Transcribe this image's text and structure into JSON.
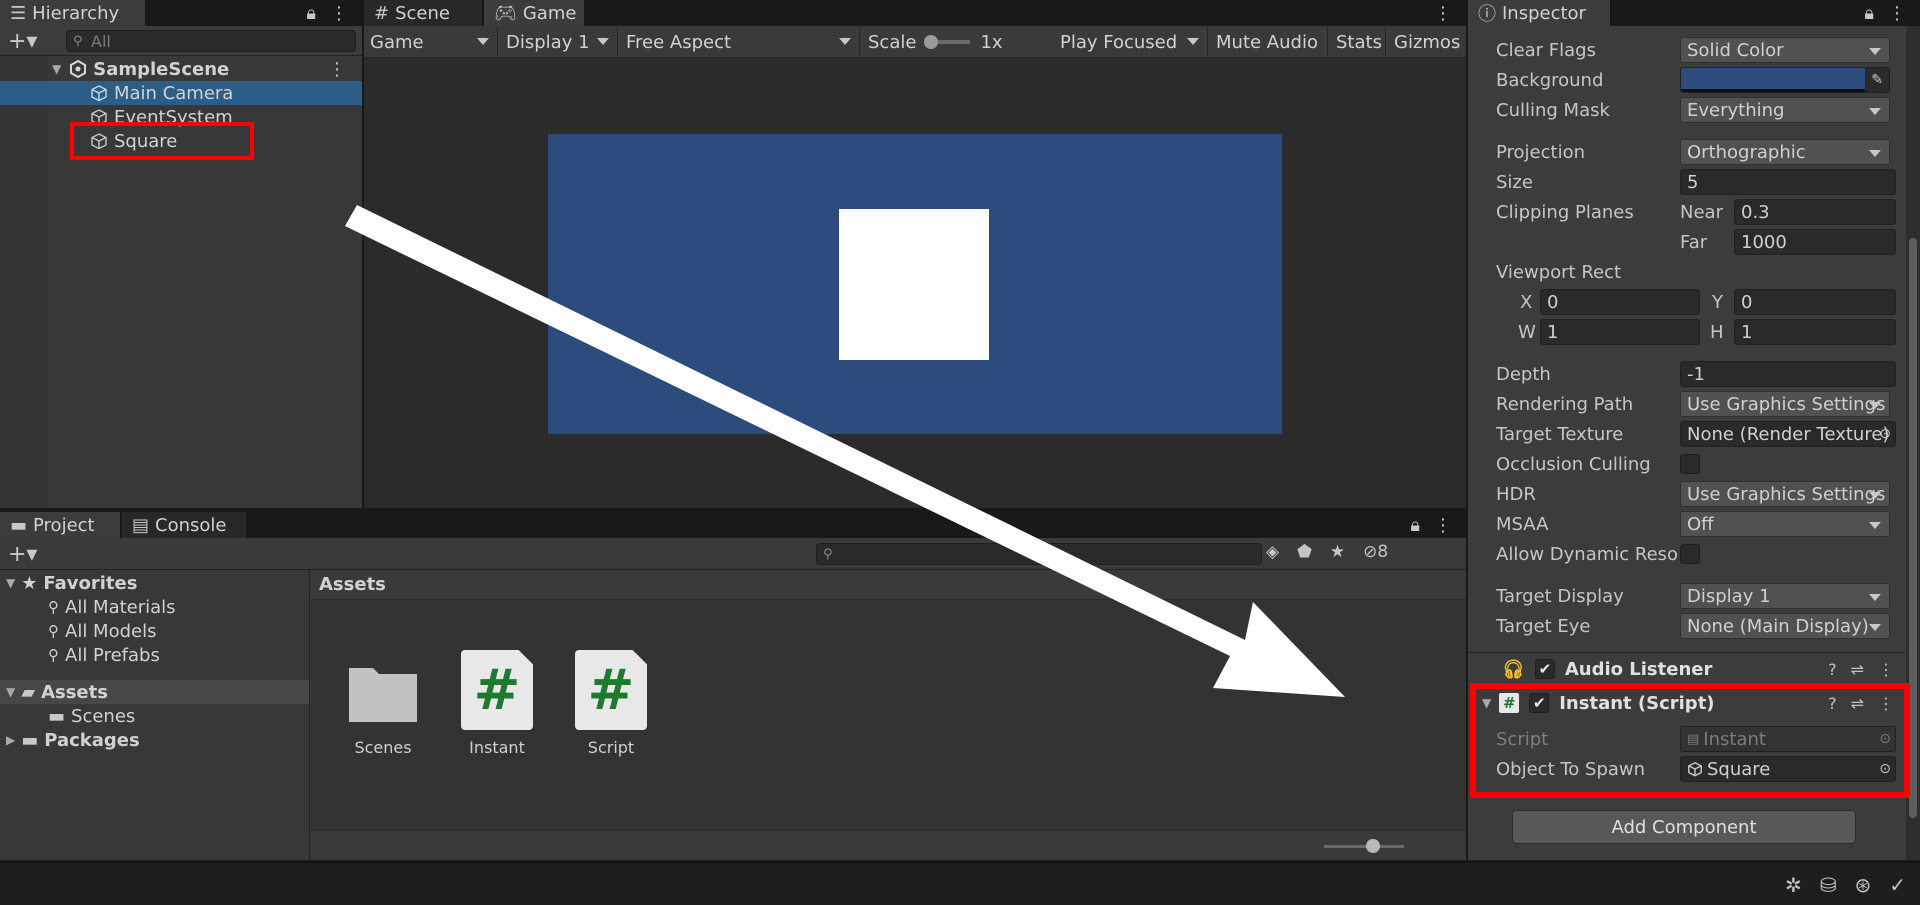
{
  "hierarchy": {
    "tab_label": "Hierarchy",
    "search_placeholder": "All",
    "scene_name": "SampleScene",
    "items": [
      {
        "label": "Main Camera",
        "selected": true
      },
      {
        "label": "EventSystem",
        "selected": false
      },
      {
        "label": "Square",
        "selected": false
      }
    ]
  },
  "center_tabs": {
    "scene": "Scene",
    "game": "Game"
  },
  "game_toolbar": {
    "mode": "Game",
    "display": "Display 1",
    "aspect": "Free Aspect",
    "scale_label": "Scale",
    "scale_value": "1x",
    "play_mode": "Play Focused",
    "mute": "Mute Audio",
    "stats": "Stats",
    "gizmos": "Gizmos"
  },
  "inspector": {
    "tab_label": "Inspector",
    "camera": {
      "clear_flags_label": "Clear Flags",
      "clear_flags": "Solid Color",
      "background_label": "Background",
      "background_color": "#2d4b7c",
      "culling_mask_label": "Culling Mask",
      "culling_mask": "Everything",
      "projection_label": "Projection",
      "projection": "Orthographic",
      "size_label": "Size",
      "size": "5",
      "clipping_label": "Clipping Planes",
      "near_label": "Near",
      "near": "0.3",
      "far_label": "Far",
      "far": "1000",
      "viewport_label": "Viewport Rect",
      "x_label": "X",
      "x": "0",
      "y_label": "Y",
      "y": "0",
      "w_label": "W",
      "w": "1",
      "h_label": "H",
      "h": "1",
      "depth_label": "Depth",
      "depth": "-1",
      "rendering_path_label": "Rendering Path",
      "rendering_path": "Use Graphics Settings",
      "target_texture_label": "Target Texture",
      "target_texture": "None (Render Texture)",
      "occlusion_label": "Occlusion Culling",
      "hdr_label": "HDR",
      "hdr": "Use Graphics Settings",
      "msaa_label": "MSAA",
      "msaa": "Off",
      "dynamic_res_label": "Allow Dynamic Reso",
      "target_display_label": "Target Display",
      "target_display": "Display 1",
      "target_eye_label": "Target Eye",
      "target_eye": "None (Main Display)"
    },
    "audio_listener": "Audio Listener",
    "instant_script": {
      "title": "Instant (Script)",
      "script_label": "Script",
      "script_value": "Instant",
      "spawn_label": "Object To Spawn",
      "spawn_value": "Square"
    },
    "add_component": "Add Component"
  },
  "project": {
    "tab_project": "Project",
    "tab_console": "Console",
    "hidden_count": "8",
    "tree": {
      "favorites": "Favorites",
      "fav_items": [
        "All Materials",
        "All Models",
        "All Prefabs"
      ],
      "assets": "Assets",
      "scenes": "Scenes",
      "packages": "Packages"
    },
    "assets_header": "Assets",
    "assets": [
      {
        "name": "Scenes",
        "kind": "folder-icon"
      },
      {
        "name": "Instant",
        "kind": "csharp-script-icon"
      },
      {
        "name": "Script",
        "kind": "csharp-script-icon"
      }
    ]
  },
  "colors": {
    "selection": "#2c5d87",
    "camera_bg": "#2d4b7c",
    "highlight": "#ff0000"
  }
}
